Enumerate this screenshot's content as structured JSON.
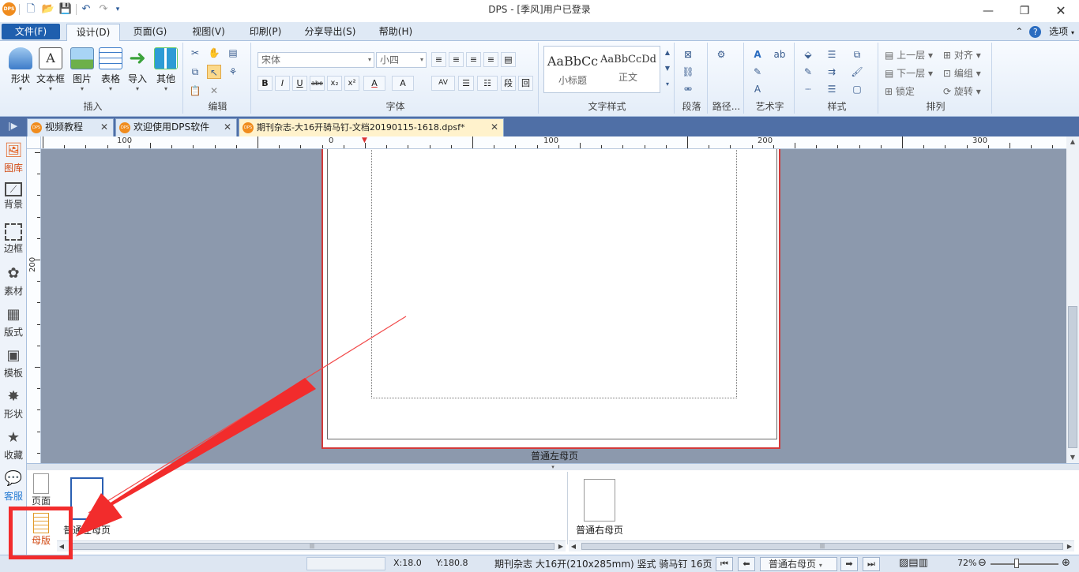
{
  "titlebar": {
    "logo": "DPS",
    "title": "DPS - [季风]用户已登录",
    "icons": [
      "new-doc-icon",
      "open-folder-icon",
      "save-icon",
      "undo-icon",
      "redo-icon",
      "quick-access-dropdown-icon"
    ]
  },
  "menu": {
    "file": "文件(F)",
    "tabs": [
      "设计(D)",
      "页面(G)",
      "视图(V)",
      "印刷(P)",
      "分享导出(S)",
      "帮助(H)"
    ],
    "active_tab": "设计(D)",
    "options": "选项"
  },
  "ribbon": {
    "insert": {
      "label": "插入",
      "buttons": [
        "形状",
        "文本框",
        "图片",
        "表格",
        "导入",
        "其他"
      ]
    },
    "edit": {
      "label": "编辑"
    },
    "font": {
      "label": "字体",
      "family": "宋体",
      "size": "小四",
      "format_buttons": [
        "B",
        "I",
        "U",
        "abe",
        "x₂",
        "x²",
        "A",
        "A"
      ],
      "para_buttons": [
        "AV",
        "段",
        "回"
      ]
    },
    "text_style": {
      "label": "文字样式",
      "styles": [
        {
          "sample": "AaBbCc",
          "name": "小标题"
        },
        {
          "sample": "AaBbCcDd",
          "name": "正文"
        }
      ]
    },
    "paragraph": {
      "label": "段落"
    },
    "path": {
      "label": "路径..."
    },
    "art_text": {
      "label": "艺术字"
    },
    "style": {
      "label": "样式"
    },
    "arrange": {
      "label": "排列",
      "items": [
        "上一层",
        "对齐",
        "下一层",
        "编组",
        "锁定",
        "旋转"
      ]
    }
  },
  "doc_tabs": [
    {
      "label": "视频教程",
      "active": false
    },
    {
      "label": "欢迎使用DPS软件",
      "active": false
    },
    {
      "label": "期刊杂志-大16开骑马钉-文档20190115-1618.dpsf*",
      "active": true
    }
  ],
  "sidebar": [
    {
      "label": "图库",
      "icon": "gallery-icon",
      "active": true
    },
    {
      "label": "背景",
      "icon": "background-icon",
      "active": false
    },
    {
      "label": "边框",
      "icon": "border-icon",
      "active": false
    },
    {
      "label": "素材",
      "icon": "material-icon",
      "active": false
    },
    {
      "label": "版式",
      "icon": "layout-grid-icon",
      "active": false
    },
    {
      "label": "模板",
      "icon": "template-icon",
      "active": false
    },
    {
      "label": "形状",
      "icon": "shape-icon",
      "active": false
    },
    {
      "label": "收藏",
      "icon": "star-icon",
      "active": false
    },
    {
      "label": "客服",
      "icon": "chat-icon",
      "active": false
    }
  ],
  "ruler": {
    "h_labels": [
      "100",
      "0",
      "100",
      "200",
      "300"
    ],
    "v_labels": [
      "200"
    ]
  },
  "canvas": {
    "page_label": "普通左母页"
  },
  "bottom_panel": {
    "tools": [
      {
        "label": "页面",
        "icon": "page-icon"
      },
      {
        "label": "母版",
        "icon": "master-page-icon"
      }
    ],
    "left_thumb_label": "普通左母页",
    "right_thumb_label": "普通右母页"
  },
  "statusbar": {
    "x": "X:18.0",
    "y": "Y:180.8",
    "doc_info": "期刊杂志 大16开(210x285mm) 竖式 骑马钉 16页",
    "page_select": "普通右母页",
    "zoom": "72%"
  },
  "colors": {
    "accent": "#1f5fae",
    "annotation": "#f22c2c",
    "canvas_bg": "#8c99ad",
    "page_border": "#d33a3a"
  }
}
